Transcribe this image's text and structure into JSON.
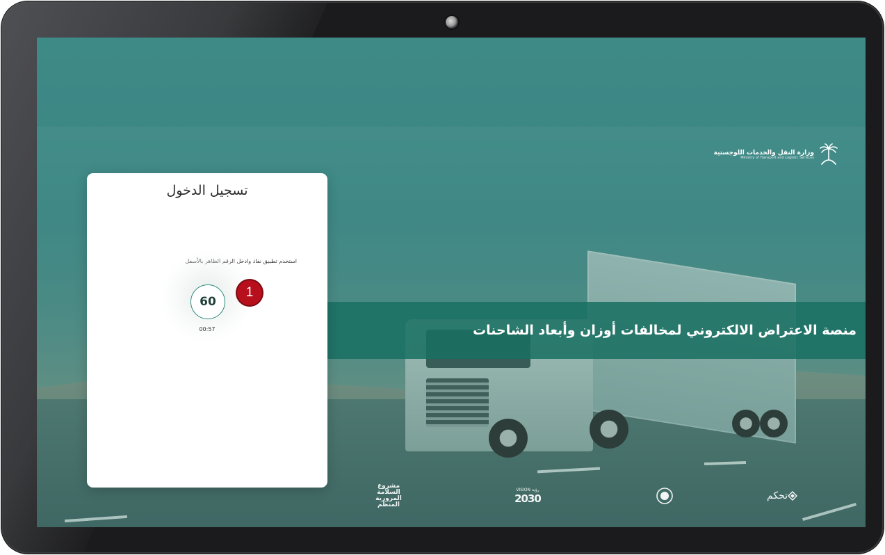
{
  "screen": {
    "banner_title": "منصة الاعتراض الالكتروني لمخالفات أوزان وأبعاد الشاحنات"
  },
  "ministry": {
    "name_ar": "وزارة النقل والخدمات اللوجستية",
    "name_en": "Ministry of Transport and Logistic Services"
  },
  "login": {
    "title": "تسجيل الدخول",
    "hint": "استخدم تطبيق نفاذ وادخل الرقم الظاهر بالأسفل",
    "code": "60",
    "timer": "00:57"
  },
  "annotation": {
    "step": "1"
  },
  "footer": {
    "safety_logo": "مشروع السلامة المرورية المنظم",
    "vision_small": "VISION رؤية",
    "vision_year": "2030",
    "tahakkom": "تحكم"
  },
  "colors": {
    "banner": "#176e62",
    "accent": "#2b8a7a",
    "badge": "#b70f1c"
  }
}
